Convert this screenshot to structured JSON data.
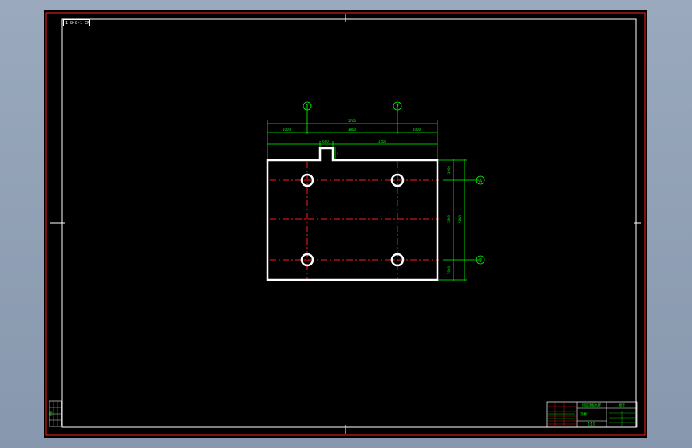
{
  "drawing": {
    "sheet_label": "1:8-8-1 CP",
    "colors": {
      "frame": "#ff2020",
      "border": "#ffffff",
      "centerline": "#ff1a1a",
      "dimension": "#00ff00",
      "part": "#ffffff",
      "background": "#000000"
    },
    "grid_axes": {
      "vertical": [
        "1",
        "2"
      ],
      "horizontal": [
        "A",
        "B"
      ]
    },
    "dimensions": {
      "overall_width": "1700",
      "segments": [
        "1000",
        "3800",
        "1000"
      ],
      "notch_width": "600",
      "notch_offset": "1500",
      "notch_depth": "3",
      "right_segments": [
        "1000",
        "3800",
        "1000"
      ],
      "overall_height": "5800"
    },
    "title_block": {
      "project": "附加顶板大样",
      "drawing_name": "顶板",
      "scale": "1:10",
      "sheet": "图号"
    },
    "revision_block": {
      "label": "修改"
    }
  }
}
